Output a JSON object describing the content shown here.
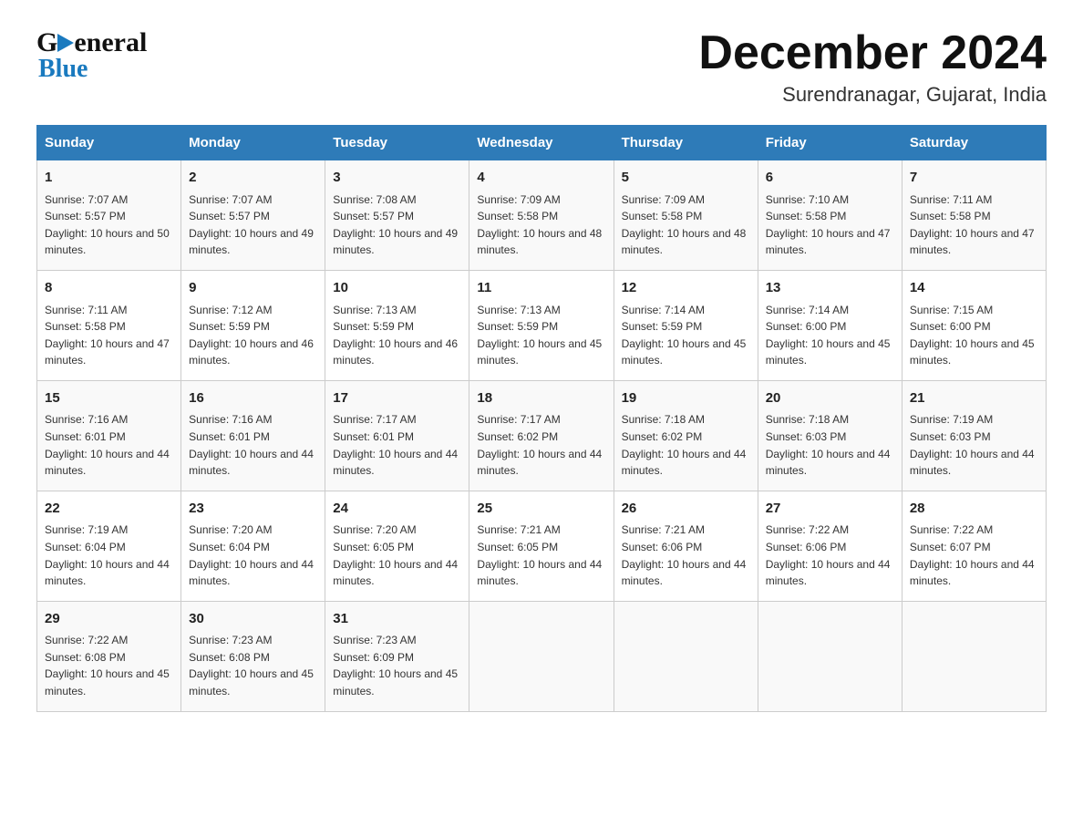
{
  "logo": {
    "general": "General",
    "blue": "Blue",
    "triangle": "▶"
  },
  "header": {
    "month": "December 2024",
    "location": "Surendranagar, Gujarat, India"
  },
  "weekdays": [
    "Sunday",
    "Monday",
    "Tuesday",
    "Wednesday",
    "Thursday",
    "Friday",
    "Saturday"
  ],
  "weeks": [
    [
      {
        "day": "1",
        "sunrise": "7:07 AM",
        "sunset": "5:57 PM",
        "daylight": "10 hours and 50 minutes."
      },
      {
        "day": "2",
        "sunrise": "7:07 AM",
        "sunset": "5:57 PM",
        "daylight": "10 hours and 49 minutes."
      },
      {
        "day": "3",
        "sunrise": "7:08 AM",
        "sunset": "5:57 PM",
        "daylight": "10 hours and 49 minutes."
      },
      {
        "day": "4",
        "sunrise": "7:09 AM",
        "sunset": "5:58 PM",
        "daylight": "10 hours and 48 minutes."
      },
      {
        "day": "5",
        "sunrise": "7:09 AM",
        "sunset": "5:58 PM",
        "daylight": "10 hours and 48 minutes."
      },
      {
        "day": "6",
        "sunrise": "7:10 AM",
        "sunset": "5:58 PM",
        "daylight": "10 hours and 47 minutes."
      },
      {
        "day": "7",
        "sunrise": "7:11 AM",
        "sunset": "5:58 PM",
        "daylight": "10 hours and 47 minutes."
      }
    ],
    [
      {
        "day": "8",
        "sunrise": "7:11 AM",
        "sunset": "5:58 PM",
        "daylight": "10 hours and 47 minutes."
      },
      {
        "day": "9",
        "sunrise": "7:12 AM",
        "sunset": "5:59 PM",
        "daylight": "10 hours and 46 minutes."
      },
      {
        "day": "10",
        "sunrise": "7:13 AM",
        "sunset": "5:59 PM",
        "daylight": "10 hours and 46 minutes."
      },
      {
        "day": "11",
        "sunrise": "7:13 AM",
        "sunset": "5:59 PM",
        "daylight": "10 hours and 45 minutes."
      },
      {
        "day": "12",
        "sunrise": "7:14 AM",
        "sunset": "5:59 PM",
        "daylight": "10 hours and 45 minutes."
      },
      {
        "day": "13",
        "sunrise": "7:14 AM",
        "sunset": "6:00 PM",
        "daylight": "10 hours and 45 minutes."
      },
      {
        "day": "14",
        "sunrise": "7:15 AM",
        "sunset": "6:00 PM",
        "daylight": "10 hours and 45 minutes."
      }
    ],
    [
      {
        "day": "15",
        "sunrise": "7:16 AM",
        "sunset": "6:01 PM",
        "daylight": "10 hours and 44 minutes."
      },
      {
        "day": "16",
        "sunrise": "7:16 AM",
        "sunset": "6:01 PM",
        "daylight": "10 hours and 44 minutes."
      },
      {
        "day": "17",
        "sunrise": "7:17 AM",
        "sunset": "6:01 PM",
        "daylight": "10 hours and 44 minutes."
      },
      {
        "day": "18",
        "sunrise": "7:17 AM",
        "sunset": "6:02 PM",
        "daylight": "10 hours and 44 minutes."
      },
      {
        "day": "19",
        "sunrise": "7:18 AM",
        "sunset": "6:02 PM",
        "daylight": "10 hours and 44 minutes."
      },
      {
        "day": "20",
        "sunrise": "7:18 AM",
        "sunset": "6:03 PM",
        "daylight": "10 hours and 44 minutes."
      },
      {
        "day": "21",
        "sunrise": "7:19 AM",
        "sunset": "6:03 PM",
        "daylight": "10 hours and 44 minutes."
      }
    ],
    [
      {
        "day": "22",
        "sunrise": "7:19 AM",
        "sunset": "6:04 PM",
        "daylight": "10 hours and 44 minutes."
      },
      {
        "day": "23",
        "sunrise": "7:20 AM",
        "sunset": "6:04 PM",
        "daylight": "10 hours and 44 minutes."
      },
      {
        "day": "24",
        "sunrise": "7:20 AM",
        "sunset": "6:05 PM",
        "daylight": "10 hours and 44 minutes."
      },
      {
        "day": "25",
        "sunrise": "7:21 AM",
        "sunset": "6:05 PM",
        "daylight": "10 hours and 44 minutes."
      },
      {
        "day": "26",
        "sunrise": "7:21 AM",
        "sunset": "6:06 PM",
        "daylight": "10 hours and 44 minutes."
      },
      {
        "day": "27",
        "sunrise": "7:22 AM",
        "sunset": "6:06 PM",
        "daylight": "10 hours and 44 minutes."
      },
      {
        "day": "28",
        "sunrise": "7:22 AM",
        "sunset": "6:07 PM",
        "daylight": "10 hours and 44 minutes."
      }
    ],
    [
      {
        "day": "29",
        "sunrise": "7:22 AM",
        "sunset": "6:08 PM",
        "daylight": "10 hours and 45 minutes."
      },
      {
        "day": "30",
        "sunrise": "7:23 AM",
        "sunset": "6:08 PM",
        "daylight": "10 hours and 45 minutes."
      },
      {
        "day": "31",
        "sunrise": "7:23 AM",
        "sunset": "6:09 PM",
        "daylight": "10 hours and 45 minutes."
      },
      {
        "day": "",
        "sunrise": "",
        "sunset": "",
        "daylight": ""
      },
      {
        "day": "",
        "sunrise": "",
        "sunset": "",
        "daylight": ""
      },
      {
        "day": "",
        "sunrise": "",
        "sunset": "",
        "daylight": ""
      },
      {
        "day": "",
        "sunrise": "",
        "sunset": "",
        "daylight": ""
      }
    ]
  ],
  "labels": {
    "sunrise": "Sunrise: ",
    "sunset": "Sunset: ",
    "daylight": "Daylight: "
  },
  "colors": {
    "header_bg": "#2e7bb8",
    "header_text": "#ffffff",
    "accent": "#1a7abf"
  }
}
